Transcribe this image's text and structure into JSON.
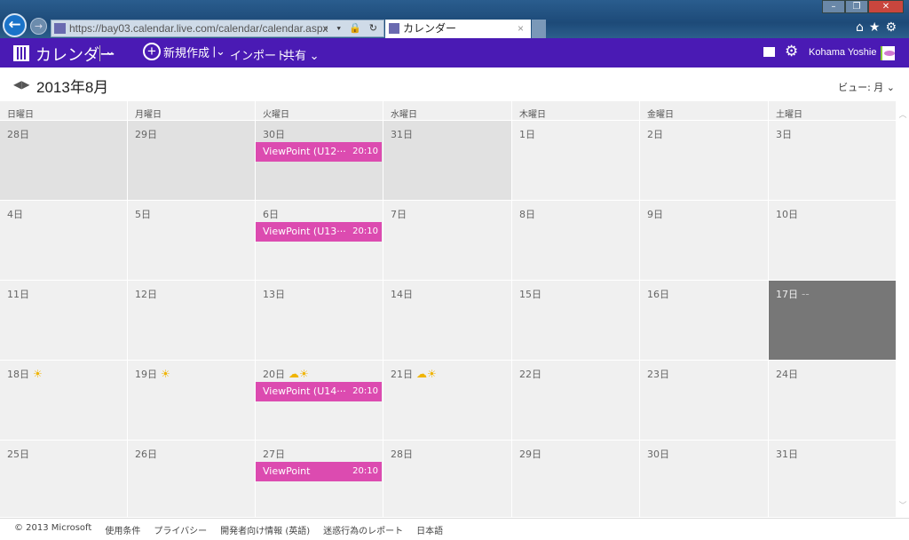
{
  "browser": {
    "url": "https://bay03.calendar.live.com/calendar/calendar.aspx",
    "tab_title": "カレンダー",
    "tools": "⌕ ▾ 🔒 ↻"
  },
  "appbar": {
    "title": "カレンダー",
    "new_label": "新規作成",
    "import_label": "インポート",
    "share_label": "共有",
    "user_name": "Kohama Yoshie",
    "accent": "#4a1ab4"
  },
  "header": {
    "month": "2013年8月",
    "view_label": "ビュー: 月"
  },
  "weekdays": [
    "日曜日",
    "月曜日",
    "火曜日",
    "水曜日",
    "木曜日",
    "金曜日",
    "土曜日"
  ],
  "weeks": [
    [
      {
        "d": "28日",
        "other": true
      },
      {
        "d": "29日",
        "other": true
      },
      {
        "d": "30日",
        "other": true,
        "event": {
          "title": "ViewPoint (U12···",
          "time": "20:10"
        }
      },
      {
        "d": "31日",
        "other": true
      },
      {
        "d": "1日"
      },
      {
        "d": "2日"
      },
      {
        "d": "3日"
      }
    ],
    [
      {
        "d": "4日"
      },
      {
        "d": "5日"
      },
      {
        "d": "6日",
        "event": {
          "title": "ViewPoint (U13···",
          "time": "20:10"
        }
      },
      {
        "d": "7日"
      },
      {
        "d": "8日"
      },
      {
        "d": "9日"
      },
      {
        "d": "10日"
      }
    ],
    [
      {
        "d": "11日"
      },
      {
        "d": "12日"
      },
      {
        "d": "13日"
      },
      {
        "d": "14日"
      },
      {
        "d": "15日"
      },
      {
        "d": "16日"
      },
      {
        "d": "17日",
        "today": true,
        "weather": "--"
      }
    ],
    [
      {
        "d": "18日",
        "weather": "☀"
      },
      {
        "d": "19日",
        "weather": "☀"
      },
      {
        "d": "20日",
        "weather": "☁☀",
        "event": {
          "title": "ViewPoint (U14···",
          "time": "20:10"
        }
      },
      {
        "d": "21日",
        "weather": "☁☀"
      },
      {
        "d": "22日"
      },
      {
        "d": "23日"
      },
      {
        "d": "24日"
      }
    ],
    [
      {
        "d": "25日"
      },
      {
        "d": "26日"
      },
      {
        "d": "27日",
        "event": {
          "title": "ViewPoint",
          "time": "20:10"
        }
      },
      {
        "d": "28日"
      },
      {
        "d": "29日"
      },
      {
        "d": "30日"
      },
      {
        "d": "31日"
      }
    ]
  ],
  "event_color": "#dc4bb0",
  "footer": [
    "© 2013 Microsoft",
    "使用条件",
    "プライバシー",
    "開発者向け情報 (英語)",
    "迷惑行為のレポート",
    "日本語"
  ]
}
